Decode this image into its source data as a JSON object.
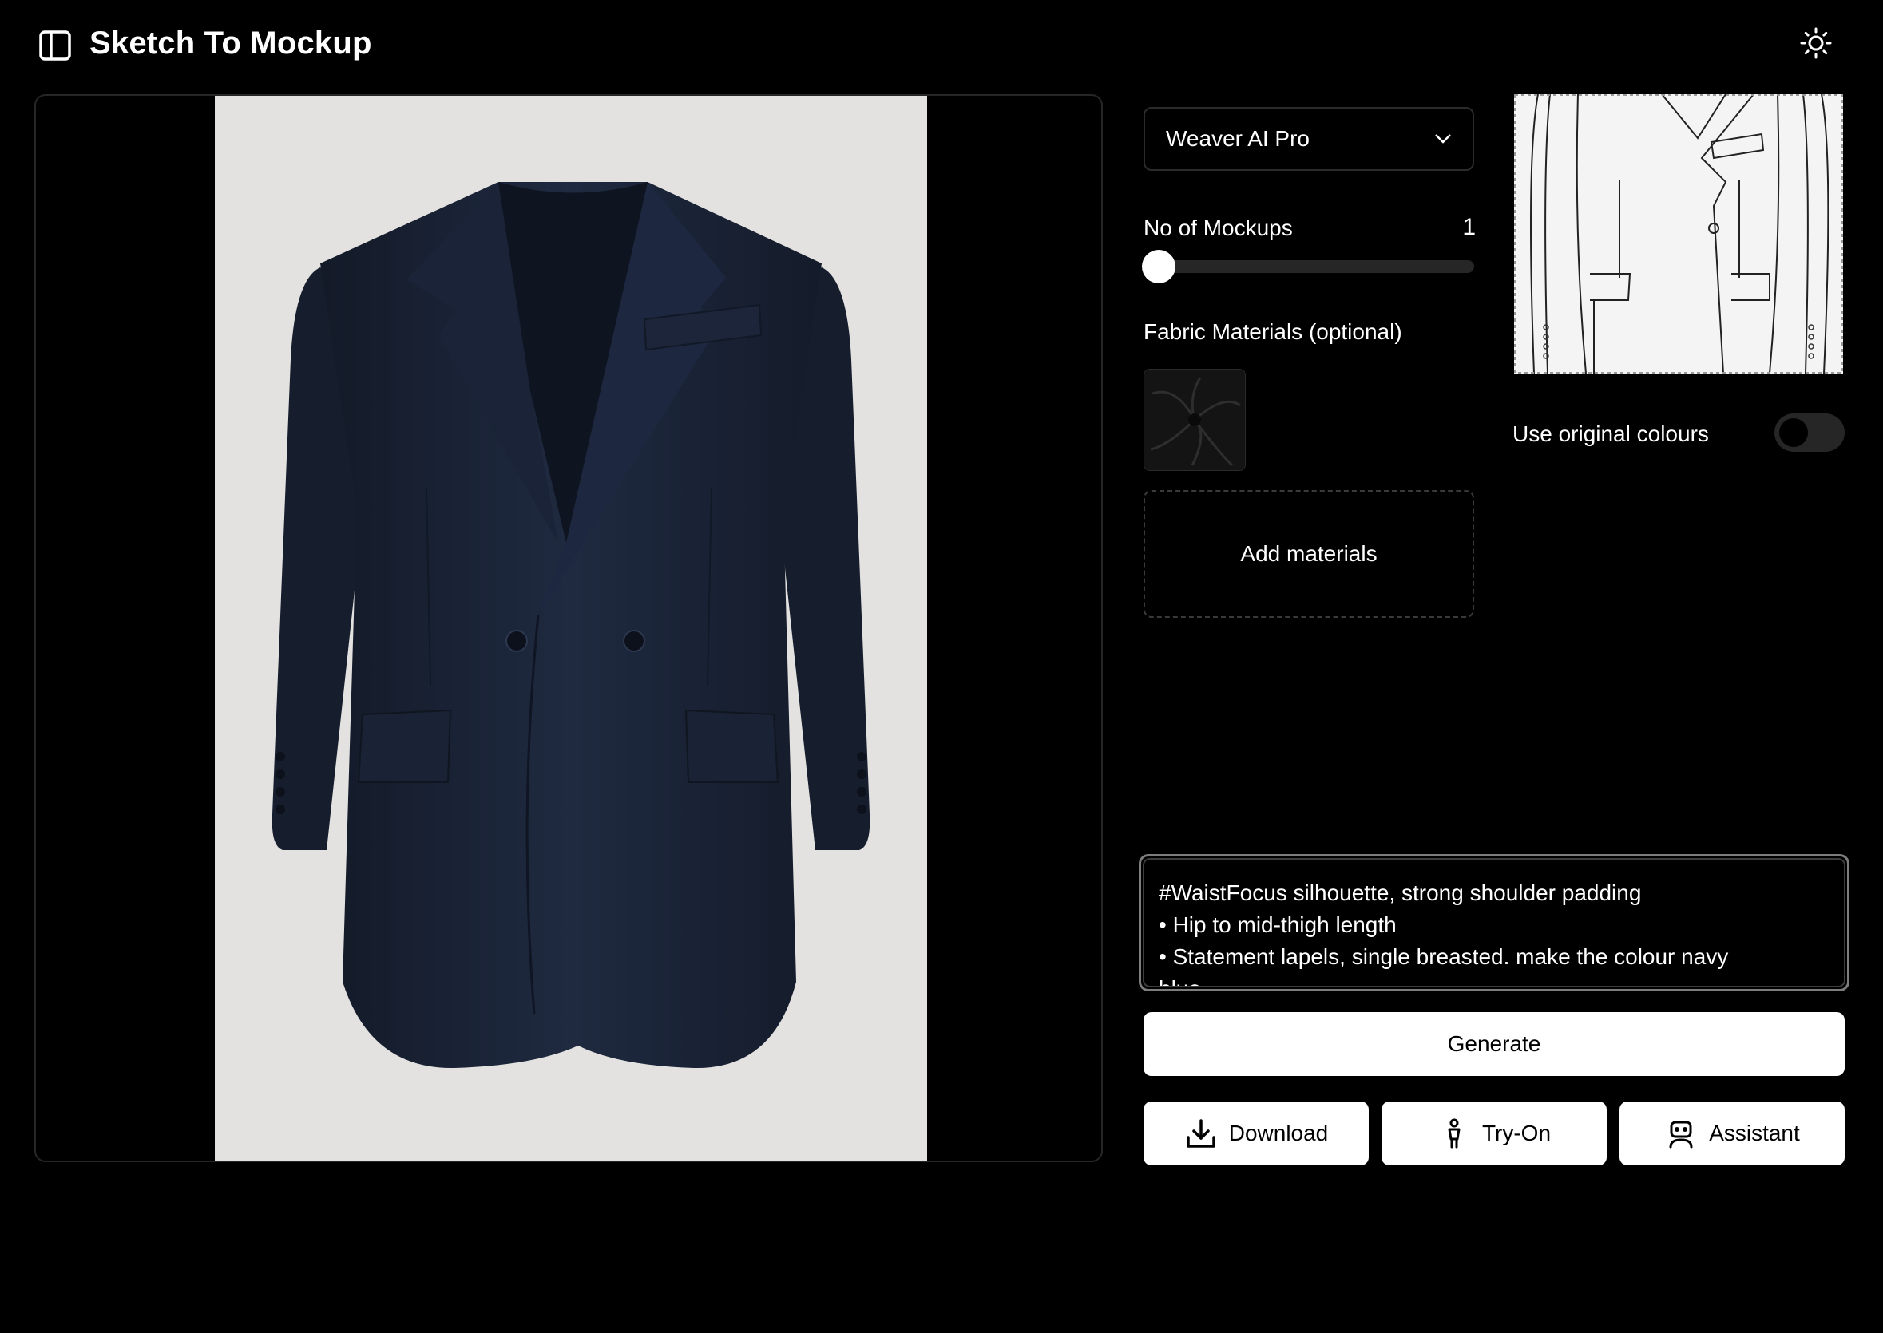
{
  "header": {
    "title": "Sketch To Mockup",
    "sidebar_toggle_icon": "sidebar-panel-icon",
    "theme_icon": "sun-icon"
  },
  "preview": {
    "image_alt": "Navy double-breasted blazer mockup"
  },
  "settings": {
    "model": "Weaver AI Pro",
    "mockups_label": "No of Mockups",
    "mockups_value": "1",
    "mockups_level": 0,
    "fabric_label": "Fabric Materials (optional)",
    "add_materials_label": "Add materials",
    "original_colours_label": "Use original colours",
    "original_colours_on": false
  },
  "prompt": {
    "text": "#WaistFocus silhouette, strong shoulder padding\n• Hip to mid-thigh length\n• Statement lapels, single breasted. make the colour navy\nblue"
  },
  "actions": {
    "generate_label": "Generate",
    "download_label": "Download",
    "tryon_label": "Try-On",
    "assistant_label": "Assistant"
  },
  "colors": {
    "background": "#000000",
    "blazer": "#1b2436",
    "mockup_bg": "#e3e2e0",
    "button_bg": "#ffffff"
  }
}
